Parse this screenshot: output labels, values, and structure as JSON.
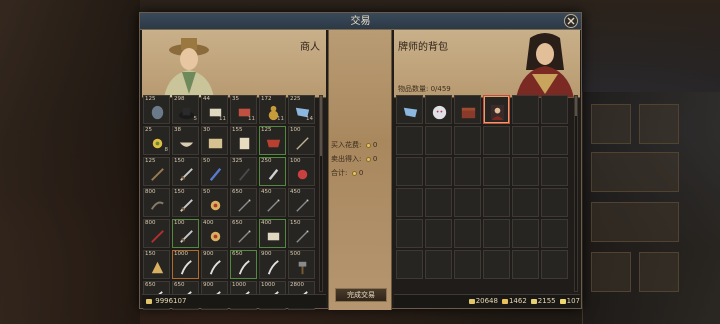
{
  "dialog": {
    "title": "交易",
    "close_label": "×"
  },
  "merchant": {
    "name": "商人",
    "money": "9996107",
    "items": [
      {
        "price": "125",
        "qty": "",
        "rarity": "",
        "icon": "mask-icon"
      },
      {
        "price": "298",
        "qty": "5",
        "rarity": "",
        "icon": "black-hat-icon"
      },
      {
        "price": "44",
        "qty": "11",
        "rarity": "",
        "icon": "scroll-icon"
      },
      {
        "price": "35",
        "qty": "11",
        "rarity": "",
        "icon": "red-scroll-icon"
      },
      {
        "price": "172",
        "qty": "11",
        "rarity": "",
        "icon": "gourd-icon"
      },
      {
        "price": "225",
        "qty": "14",
        "rarity": "",
        "icon": "blue-cloth-icon"
      },
      {
        "price": "25",
        "qty": "8",
        "rarity": "",
        "icon": "flower-icon"
      },
      {
        "price": "38",
        "qty": "",
        "rarity": "",
        "icon": "bowl-icon"
      },
      {
        "price": "30",
        "qty": "",
        "rarity": "",
        "icon": "map-scroll-icon"
      },
      {
        "price": "155",
        "qty": "",
        "rarity": "",
        "icon": "paper-icon"
      },
      {
        "price": "125",
        "qty": "",
        "rarity": "green",
        "icon": "red-cloth-icon"
      },
      {
        "price": "100",
        "qty": "",
        "rarity": "",
        "icon": "needle-icon"
      },
      {
        "price": "125",
        "qty": "",
        "rarity": "",
        "icon": "staff-icon"
      },
      {
        "price": "150",
        "qty": "",
        "rarity": "",
        "icon": "sword-icon"
      },
      {
        "price": "50",
        "qty": "",
        "rarity": "",
        "icon": "blue-blade-icon"
      },
      {
        "price": "325",
        "qty": "",
        "rarity": "",
        "icon": "rod-icon"
      },
      {
        "price": "250",
        "qty": "",
        "rarity": "green",
        "icon": "dagger-icon"
      },
      {
        "price": "100",
        "qty": "",
        "rarity": "",
        "icon": "red-flower-icon"
      },
      {
        "price": "800",
        "qty": "",
        "rarity": "",
        "icon": "claw-icon"
      },
      {
        "price": "150",
        "qty": "",
        "rarity": "",
        "icon": "sword-icon"
      },
      {
        "price": "50",
        "qty": "",
        "rarity": "",
        "icon": "jade-icon"
      },
      {
        "price": "650",
        "qty": "",
        "rarity": "",
        "icon": "spear-icon"
      },
      {
        "price": "450",
        "qty": "",
        "rarity": "",
        "icon": "spear-icon"
      },
      {
        "price": "450",
        "qty": "",
        "rarity": "",
        "icon": "spear-icon"
      },
      {
        "price": "800",
        "qty": "",
        "rarity": "",
        "icon": "red-sword-icon"
      },
      {
        "price": "100",
        "qty": "",
        "rarity": "green",
        "icon": "sword-icon"
      },
      {
        "price": "400",
        "qty": "",
        "rarity": "",
        "icon": "jade-icon"
      },
      {
        "price": "650",
        "qty": "",
        "rarity": "",
        "icon": "spear-icon"
      },
      {
        "price": "400",
        "qty": "",
        "rarity": "green",
        "icon": "scroll-icon"
      },
      {
        "price": "150",
        "qty": "",
        "rarity": "",
        "icon": "spear-icon"
      },
      {
        "price": "150",
        "qty": "",
        "rarity": "",
        "icon": "fan-icon"
      },
      {
        "price": "1000",
        "qty": "",
        "rarity": "orange",
        "icon": "saber-icon"
      },
      {
        "price": "900",
        "qty": "",
        "rarity": "",
        "icon": "saber-icon"
      },
      {
        "price": "650",
        "qty": "",
        "rarity": "green",
        "icon": "saber-icon"
      },
      {
        "price": "900",
        "qty": "",
        "rarity": "",
        "icon": "saber-icon"
      },
      {
        "price": "500",
        "qty": "",
        "rarity": "",
        "icon": "hammer-icon"
      },
      {
        "price": "650",
        "qty": "",
        "rarity": "",
        "icon": "saber-icon"
      },
      {
        "price": "650",
        "qty": "",
        "rarity": "",
        "icon": "saber-icon"
      },
      {
        "price": "900",
        "qty": "",
        "rarity": "",
        "icon": "saber-icon"
      },
      {
        "price": "1000",
        "qty": "",
        "rarity": "",
        "icon": "saber-icon"
      },
      {
        "price": "1000",
        "qty": "",
        "rarity": "",
        "icon": "saber-icon"
      },
      {
        "price": "2800",
        "qty": "",
        "rarity": "",
        "icon": "saber-icon"
      }
    ]
  },
  "player": {
    "name": "牌师的背包",
    "item_count": "物品数量: 0/459",
    "items": [
      {
        "icon": "blue-cloth-icon",
        "rarity": ""
      },
      {
        "icon": "lion-icon",
        "rarity": ""
      },
      {
        "icon": "chest-icon",
        "rarity": ""
      },
      {
        "icon": "portrait-card-icon",
        "rarity": "sel"
      }
    ],
    "empty_slots": 32,
    "currency": [
      {
        "icon": "coin-icon",
        "value": "20648",
        "color": "#e2c46b"
      },
      {
        "icon": "silver-icon",
        "value": "1462",
        "color": "#e8c15a"
      },
      {
        "icon": "gold-bar-icon",
        "value": "2155",
        "color": "#e7cf74"
      },
      {
        "icon": "ingot-icon",
        "value": "107",
        "color": "#f0d870"
      }
    ]
  },
  "trade": {
    "buy_cost_label": "买入花费:",
    "buy_cost_value": "0",
    "sell_income_label": "卖出得入:",
    "sell_income_value": "0",
    "total_label": "合计:",
    "total_value": "0",
    "complete_button": "完成交易"
  }
}
